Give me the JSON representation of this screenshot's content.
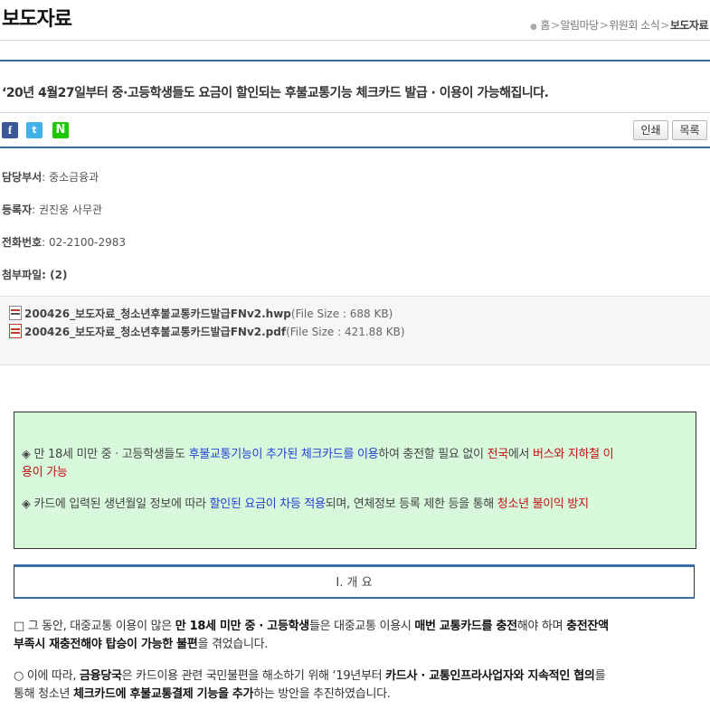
{
  "header": {
    "title": "보도자료",
    "breadcrumb": [
      "홈",
      "알림마당",
      "위원회 소식",
      "보도자료"
    ]
  },
  "article": {
    "title": "‘20년 4월27일부터 중·고등학생들도 요금이 할인되는 후불교통기능 체크카드 발급 · 이용이 가능해집니다.",
    "share_icons": [
      "facebook-icon",
      "twitter-icon",
      "naver-icon"
    ],
    "buttons": {
      "print": "인쇄",
      "list": "목록"
    }
  },
  "meta": {
    "dept_label": "담당부서",
    "dept": ": 중소금융과",
    "author_label": "등록자",
    "author": ": 권진웅 사무관",
    "phone_label": "전화번호",
    "phone": ": 02-2100-2983",
    "attach_label": "첨부파일",
    "attach_count": ": (2)"
  },
  "attachments": [
    {
      "name": "200426_보도자료_청소년후불교통카드발급FNv2.hwp",
      "size": "(File Size : 688 KB)",
      "type": "hwp"
    },
    {
      "name": "200426_보도자료_청소년후불교통카드발급FNv2.pdf",
      "size": "(File Size : 421.88 KB)",
      "type": "pdf"
    }
  ],
  "summary": {
    "l1_a": "◈ 만 18세 미만 중 · 고등학생들도 ",
    "l1_b": "후불교통기능이 추가된 체크카드를 이용",
    "l1_c": "하여 충전할 필요 없이 ",
    "l1_d": "전국",
    "l1_e": "에서 ",
    "l1_f": "버스와 지하철 이",
    "l1_g": "용이 가능",
    "l2_a": "◈ 카드에 입력된 생년월일 정보에 따라 ",
    "l2_b": "할인된 요금이 차등 적용",
    "l2_c": "되며, 연체정보 등록 제한 등을 통해 ",
    "l2_d": "청소년 불이익 방지"
  },
  "overview": {
    "heading": "Ⅰ. 개 요"
  },
  "body": {
    "p1_a": "□ 그 동안, 대중교통 이용이 많은 ",
    "p1_b": "만 18세 미만 중 · 고등학생",
    "p1_c": "들은 대중교통 이용시 ",
    "p1_d": "매번 교통카드를 충전",
    "p1_e": "해야 하며 ",
    "p1_f": "충전잔액",
    "p1_g": "부족시 재충전해야 탑승이 가능한 불편",
    "p1_h": "을 겪었습니다.",
    "p2_a": "○ 이에 따라, ",
    "p2_b": "금융당국",
    "p2_c": "은 카드이용 관련 국민불편을 해소하기 위해 ‘19년부터 ",
    "p2_d": "카드사 · 교통인프라사업자와 지속적인 협의",
    "p2_e": "를",
    "p2_f": "통해 청소년 ",
    "p2_g": "체크카드에 후불교통결제 기능을 추가",
    "p2_h": "하는 방안을 추진하였습니다."
  }
}
